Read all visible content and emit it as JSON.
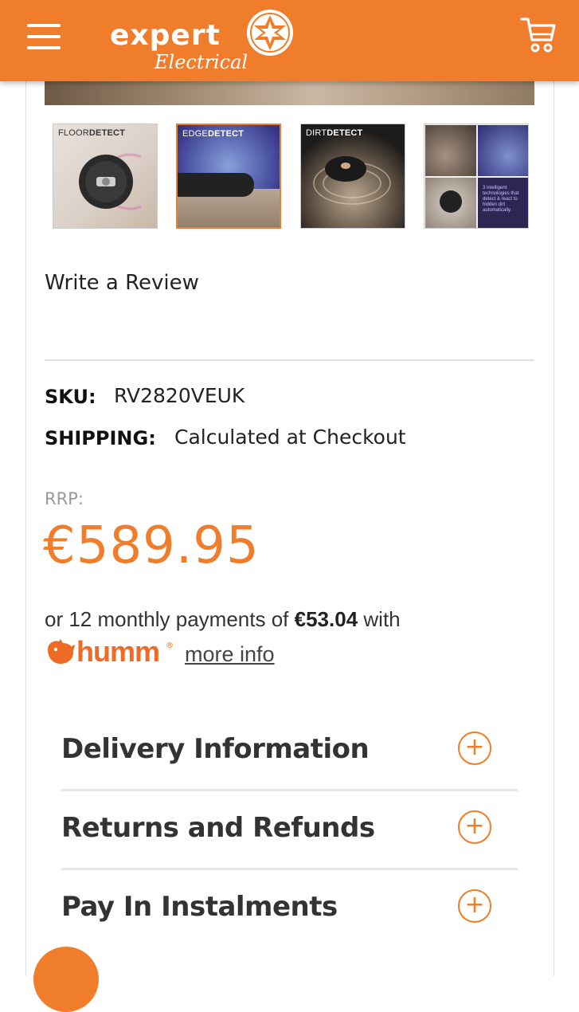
{
  "header": {
    "logo_word": "expert",
    "logo_sub": "Electrical",
    "brand_color": "#ef7d2b",
    "menu_icon": "hamburger-menu-icon",
    "cart_icon": "shopping-cart-icon"
  },
  "gallery": {
    "thumbnails": [
      {
        "title_light": "FLOOR",
        "title_bold": "DETECT",
        "active": false
      },
      {
        "title_light": "EDGE",
        "title_bold": "DETECT",
        "active": true
      },
      {
        "title_light": "DIRT",
        "title_bold": "DETECT",
        "active": false
      },
      {
        "overlay_text": "3 intelligent technologies that detect & react to hidden dirt automatically.",
        "active": false
      }
    ]
  },
  "review": {
    "label": "Write a Review"
  },
  "specs": {
    "sku_label": "SKU:",
    "sku_value": "RV2820VEUK",
    "shipping_label": "SHIPPING:",
    "shipping_value": "Calculated at Checkout"
  },
  "pricing": {
    "rrp_label": "RRP:",
    "price": "€589.95",
    "finance_prefix": "or 12 monthly payments of",
    "finance_amount": "€53.04",
    "finance_suffix": "with",
    "humm_brand": "humm",
    "more_info": "more info"
  },
  "accordion": [
    {
      "title": "Delivery Information"
    },
    {
      "title": "Returns and Refunds"
    },
    {
      "title": "Pay In Instalments"
    }
  ]
}
